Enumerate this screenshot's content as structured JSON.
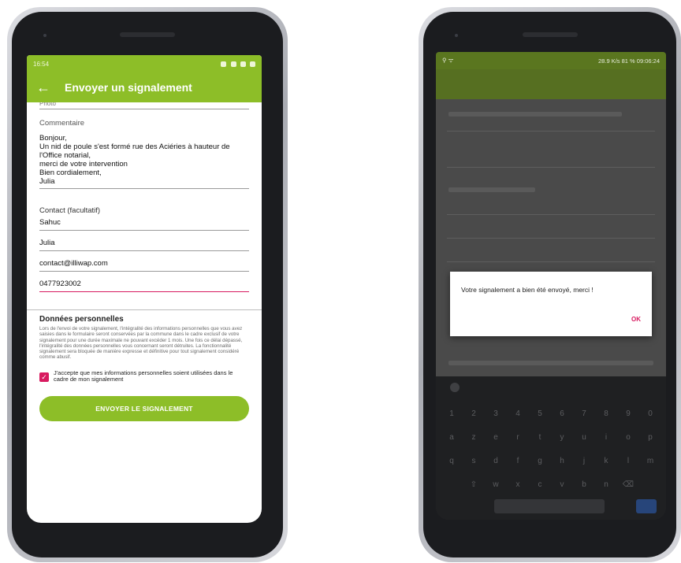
{
  "left_phone": {
    "status_time": "16:54",
    "app_title": "Envoyer un signalement",
    "cut_field_text": "Photo",
    "comment_label": "Commentaire",
    "comment_text": "Bonjour,\nUn nid de poule s'est formé rue des Aciéries à hauteur de l'Office notarial,\nmerci de votre intervention\nBien cordialement,\nJulia",
    "contact_label": "Contact (facultatif)",
    "contact_fields": [
      "Sahuc",
      "Julia",
      "contact@illiwap.com",
      "0477923002"
    ],
    "rgpd_title": "Données personnelles",
    "rgpd_text": "Lors de l'envoi de votre signalement, l'intégralité des informations personnelles que vous avez saisies dans le formulaire seront conservées par la commune dans le cadre exclusif de votre signalement pour une durée maximale ne pouvant excéder 1 mois. Une fois ce délai dépassé, l'intégralité des données personnelles vous concernant seront détruites. La fonctionnalité signalement sera bloquée de manière expresse et définitive pour tout signalement considéré comme abusif.",
    "consent_text": "J'accepte que mes informations personnelles soient utilisées dans le cadre de mon signalement",
    "consent_checked": true,
    "submit_label": "ENVOYER LE SIGNALEMENT"
  },
  "right_phone": {
    "status_text": "28.9 K/s 81 % 09:06:24",
    "dialog_message": "Votre signalement a bien été envoyé, merci !",
    "dialog_ok": "OK",
    "keyboard_rows": [
      [
        "1",
        "2",
        "3",
        "4",
        "5",
        "6",
        "7",
        "8",
        "9",
        "0"
      ],
      [
        "a",
        "z",
        "e",
        "r",
        "t",
        "y",
        "u",
        "i",
        "o",
        "p"
      ],
      [
        "q",
        "s",
        "d",
        "f",
        "g",
        "h",
        "j",
        "k",
        "l",
        "m"
      ],
      [
        "w",
        "x",
        "c",
        "v",
        "b",
        "n"
      ]
    ]
  },
  "colors": {
    "brand_green": "#8dbe28",
    "accent_pink": "#d81b60"
  }
}
